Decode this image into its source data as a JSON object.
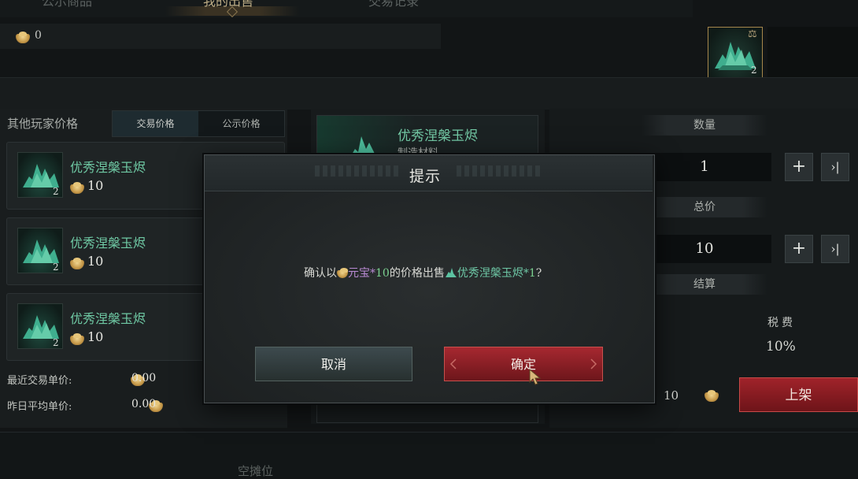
{
  "tabs": [
    {
      "label": "公示商品",
      "active": false
    },
    {
      "label": "我的出售",
      "active": true
    },
    {
      "label": "交易记录",
      "active": false
    }
  ],
  "currency": {
    "icon": "gold-ingot-icon",
    "amount": "0"
  },
  "top_item": {
    "count": "2",
    "icon": "scale-icon"
  },
  "left_panel": {
    "title": "其他玩家价格",
    "tabs": {
      "trade_price": "交易价格",
      "public_price": "公示价格"
    },
    "listings": [
      {
        "name": "优秀涅槃玉烬",
        "count": "2",
        "price": "10"
      },
      {
        "name": "优秀涅槃玉烬",
        "count": "2",
        "price": "10"
      },
      {
        "name": "优秀涅槃玉烬",
        "count": "2",
        "price": "10"
      }
    ],
    "recent_label": "最近交易单价:",
    "recent_value": "0.00",
    "yesterday_label": "昨日平均单价:",
    "yesterday_value": "0.00"
  },
  "item": {
    "name": "优秀涅槃玉烬",
    "type": "制造材料"
  },
  "right_panel": {
    "quantity_label": "数量",
    "quantity_value": "1",
    "total_label": "总价",
    "total_value": "10",
    "settle_label": "结算",
    "tax_label": "税费",
    "tax_value": "10%",
    "settle_amount": "10",
    "list_button": "上架"
  },
  "bottom": {
    "empty_slot": "空摊位"
  },
  "dialog": {
    "title": "提示",
    "msg_prefix": "确认以",
    "msg_currency": "元宝",
    "msg_times": "*",
    "msg_amount": "10",
    "msg_middle": "的价格出售",
    "msg_item": "优秀涅槃玉烬",
    "msg_times2": "*",
    "msg_qty": "1",
    "msg_suffix": "?",
    "cancel": "取消",
    "confirm": "确定"
  },
  "colors": {
    "accent_green": "#6fc9a4",
    "confirm_red": "#a62830",
    "gold": "#e0b968",
    "currency_purple": "#b98ad3"
  }
}
